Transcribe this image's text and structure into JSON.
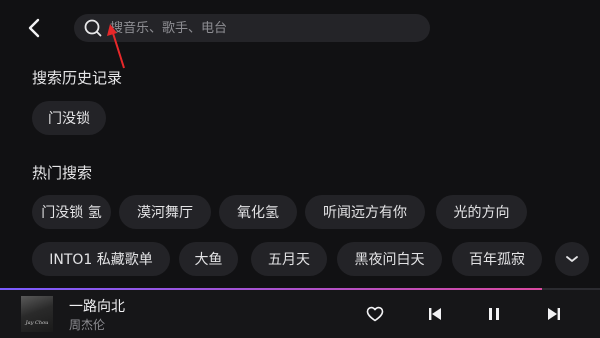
{
  "search": {
    "placeholder": "搜音乐、歌手、电台"
  },
  "history": {
    "title": "搜索历史记录",
    "items": [
      "门没锁"
    ]
  },
  "hot": {
    "title": "热门搜索",
    "items": [
      "门没锁 氢",
      "漠河舞厅",
      "氧化氢",
      "听闻远方有你",
      "光的方向",
      "INTO1 私藏歌单",
      "大鱼",
      "五月天",
      "黑夜问白天",
      "百年孤寂"
    ]
  },
  "player": {
    "song": "一路向北",
    "artist": "周杰伦",
    "cover_text": "Jay Chou",
    "progress": 0.903
  },
  "colors": {
    "accent_start": "#7a5cff",
    "accent_end": "#d94aa0",
    "background": "#111113"
  },
  "icons": [
    "back-arrow-icon",
    "search-icon",
    "chevron-down-icon",
    "heart-icon",
    "previous-icon",
    "pause-icon",
    "next-icon"
  ]
}
